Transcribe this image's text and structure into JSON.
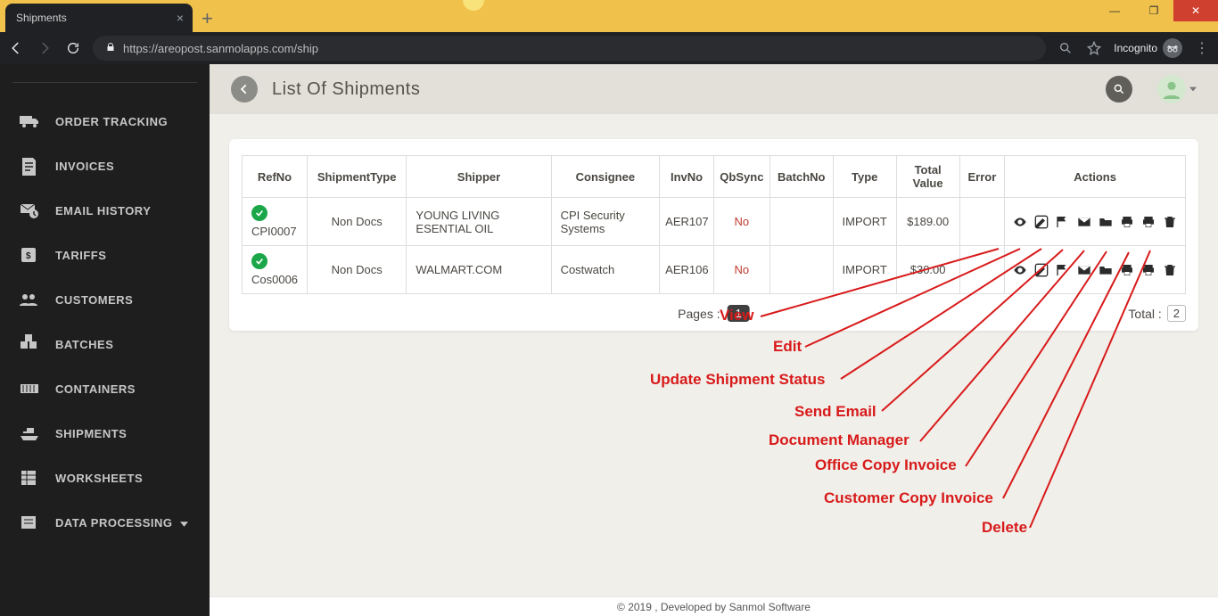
{
  "browser": {
    "tab_title": "Shipments",
    "url": "https://areopost.sanmolapps.com/ship",
    "incognito_label": "Incognito"
  },
  "sidebar": {
    "items": [
      {
        "label": "ORDER TRACKING",
        "name": "sidebar-item-order-tracking"
      },
      {
        "label": "INVOICES",
        "name": "sidebar-item-invoices"
      },
      {
        "label": "EMAIL HISTORY",
        "name": "sidebar-item-email-history"
      },
      {
        "label": "TARIFFS",
        "name": "sidebar-item-tariffs"
      },
      {
        "label": "CUSTOMERS",
        "name": "sidebar-item-customers"
      },
      {
        "label": "BATCHES",
        "name": "sidebar-item-batches"
      },
      {
        "label": "CONTAINERS",
        "name": "sidebar-item-containers"
      },
      {
        "label": "SHIPMENTS",
        "name": "sidebar-item-shipments"
      },
      {
        "label": "WORKSHEETS",
        "name": "sidebar-item-worksheets"
      },
      {
        "label": "DATA PROCESSING",
        "name": "sidebar-item-data-processing",
        "has_caret": true
      }
    ]
  },
  "header": {
    "title": "List Of Shipments"
  },
  "table": {
    "columns": [
      "RefNo",
      "ShipmentType",
      "Shipper",
      "Consignee",
      "InvNo",
      "QbSync",
      "BatchNo",
      "Type",
      "Total Value",
      "Error",
      "Actions"
    ],
    "rows": [
      {
        "refno": "CPI0007",
        "stype": "Non Docs",
        "shipper": "YOUNG LIVING ESENTIAL OIL",
        "consignee": "CPI Security Systems",
        "invno": "AER107",
        "qbsync": "No",
        "batchno": "",
        "type": "IMPORT",
        "total": "$189.00",
        "error": ""
      },
      {
        "refno": "Cos0006",
        "stype": "Non Docs",
        "shipper": "WALMART.COM",
        "consignee": "Costwatch",
        "invno": "AER106",
        "qbsync": "No",
        "batchno": "",
        "type": "IMPORT",
        "total": "$30.00",
        "error": ""
      }
    ],
    "pages_label": "Pages :",
    "page_current": "1",
    "total_label": "Total :",
    "total_value": "2"
  },
  "annotations": [
    {
      "label": "View"
    },
    {
      "label": "Edit"
    },
    {
      "label": "Update Shipment Status"
    },
    {
      "label": "Send Email"
    },
    {
      "label": "Document Manager"
    },
    {
      "label": "Office Copy Invoice"
    },
    {
      "label": "Customer Copy Invoice"
    },
    {
      "label": "Delete"
    }
  ],
  "footer": "© 2019 , Developed by Sanmol Software"
}
